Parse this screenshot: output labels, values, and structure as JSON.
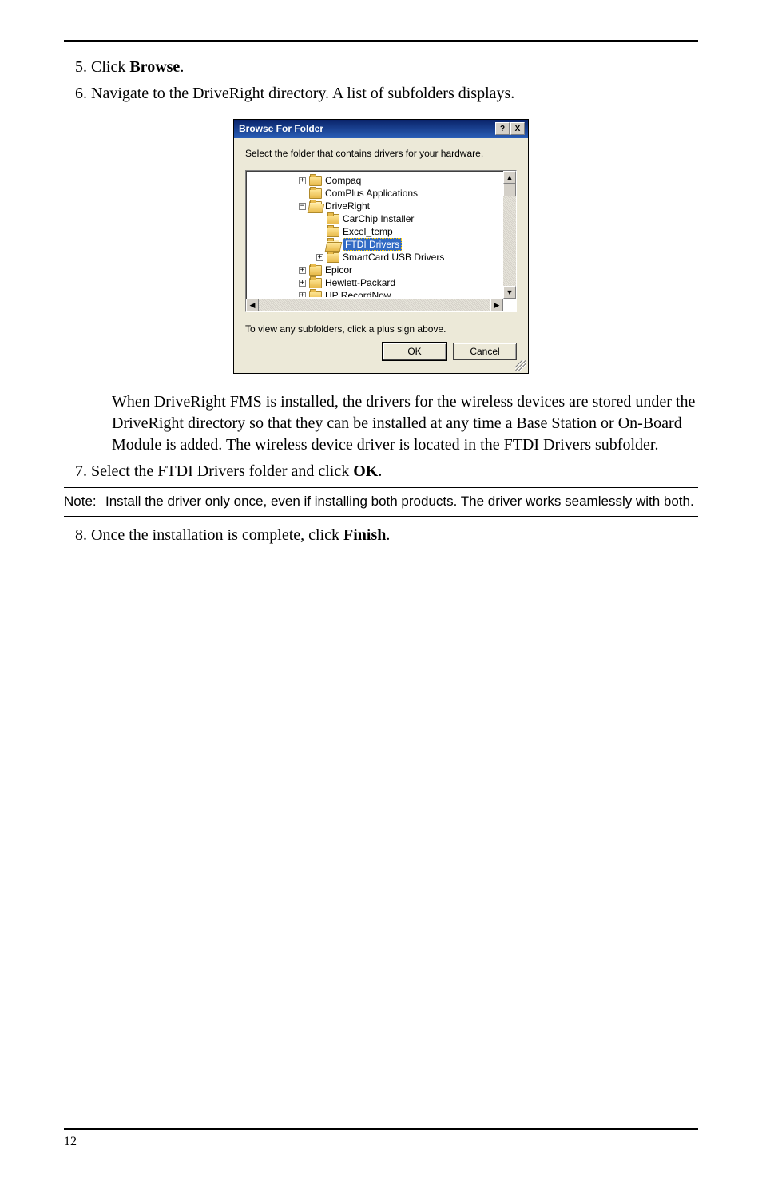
{
  "steps_a": {
    "5": {
      "pre": "Click ",
      "bold": "Browse",
      "post": "."
    },
    "6": {
      "text": "Navigate to the DriveRight directory. A list of subfolders displays."
    }
  },
  "dialog": {
    "title": "Browse For Folder",
    "help_btn": "?",
    "close_btn": "X",
    "instruction": "Select the folder that contains drivers for your hardware.",
    "tree": {
      "n0": {
        "exp": "+",
        "label": "Compaq"
      },
      "n1": {
        "label": "ComPlus Applications"
      },
      "n2": {
        "exp": "−",
        "label": "DriveRight"
      },
      "n3": {
        "label": "CarChip Installer"
      },
      "n4": {
        "label": "Excel_temp"
      },
      "n5": {
        "label": "FTDI Drivers"
      },
      "n6": {
        "exp": "+",
        "label": "SmartCard USB Drivers"
      },
      "n7": {
        "exp": "+",
        "label": "Epicor"
      },
      "n8": {
        "exp": "+",
        "label": "Hewlett-Packard"
      },
      "n9": {
        "exp": "+",
        "label": "HP RecordNow"
      }
    },
    "hint": "To view any subfolders, click a plus sign above.",
    "ok": "OK",
    "cancel": "Cancel",
    "scroll": {
      "up": "▲",
      "down": "▼",
      "left": "◀",
      "right": "▶"
    }
  },
  "para": "When DriveRight FMS is installed, the drivers for the wireless devices are stored under the DriveRight directory so that they can be installed at any time a Base Station or On-Board Module is added. The wireless device driver is located in the FTDI Drivers subfolder.",
  "steps_b": {
    "7": {
      "pre": "Select the FTDI Drivers folder and click ",
      "bold": "OK",
      "post": "."
    }
  },
  "note": {
    "label": "Note:",
    "text": "Install the driver only once, even if installing both products. The driver works seamlessly with both."
  },
  "steps_c": {
    "8": {
      "pre": "Once the installation is complete, click ",
      "bold": "Finish",
      "post": "."
    }
  },
  "page_number": "12"
}
